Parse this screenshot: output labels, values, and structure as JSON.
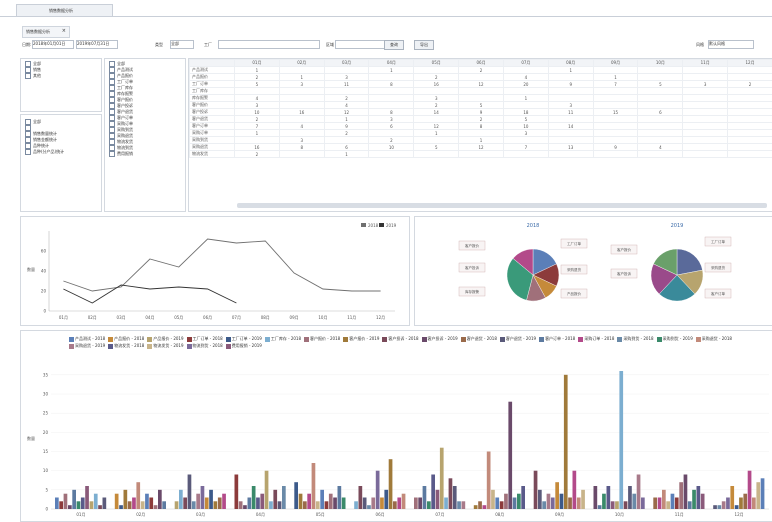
{
  "window": {
    "tab_label": "销售数据分析"
  },
  "document": {
    "tab_label": "销售数据分析"
  },
  "toolbar": {
    "date_label": "日期:",
    "date_from": "2018年01月01日",
    "date_to": "2019年07月31日",
    "type_label": "类型",
    "type_value": "全部",
    "factory_label": "工厂",
    "factory_value": "",
    "dept_label": "区域",
    "dept_value": "",
    "query_button": "查询",
    "export_button": "导出",
    "style_label": "风格",
    "style_value": "默认风格"
  },
  "left_tree_top": {
    "items": [
      "全部",
      "销售",
      "其他"
    ]
  },
  "left_tree_bottom": {
    "items": [
      "全部",
      "",
      "销售数量统计",
      "销售金额统计",
      "品种统计",
      "品种(分产品)统计"
    ]
  },
  "middle_list": {
    "items": [
      "全部",
      "产品测试",
      "产品报价",
      "工厂订单",
      "工厂库存",
      "库存报警",
      "客户报价",
      "客户投诉",
      "客户退货",
      "客户订单",
      "采购订单",
      "采购到货",
      "采购退货",
      "物流发货",
      "物流到货",
      "费用报销"
    ]
  },
  "grid": {
    "header": [
      "",
      "01月",
      "02月",
      "03月",
      "04月",
      "05月",
      "06月",
      "07月",
      "08月",
      "09月",
      "10月",
      "11月",
      "12月"
    ],
    "rows": [
      {
        "label": "产品测试",
        "values": [
          "1",
          "",
          "",
          "1",
          "",
          "2",
          "",
          "1",
          "",
          "",
          "",
          ""
        ]
      },
      {
        "label": "产品报价",
        "values": [
          "2",
          "1",
          "3",
          "",
          "2",
          "",
          "4",
          "",
          "1",
          "",
          "",
          ""
        ]
      },
      {
        "label": "工厂订单",
        "values": [
          "5",
          "3",
          "11",
          "8",
          "16",
          "12",
          "20",
          "9",
          "7",
          "5",
          "3",
          "2"
        ]
      },
      {
        "label": "工厂库存",
        "values": [
          "",
          "",
          "",
          "",
          "",
          "",
          "",
          "",
          "",
          "",
          "",
          ""
        ]
      },
      {
        "label": "库存报警",
        "values": [
          "4",
          "",
          "2",
          "",
          "3",
          "",
          "1",
          "",
          "",
          "",
          "",
          ""
        ]
      },
      {
        "label": "客户报价",
        "values": [
          "3",
          "",
          "4",
          "",
          "2",
          "5",
          "",
          "3",
          "",
          "",
          "",
          ""
        ]
      },
      {
        "label": "客户投诉",
        "values": [
          "10",
          "16",
          "12",
          "8",
          "14",
          "9",
          "18",
          "11",
          "15",
          "6",
          "",
          ""
        ]
      },
      {
        "label": "客户退货",
        "values": [
          "2",
          "",
          "1",
          "3",
          "",
          "2",
          "5",
          "",
          "",
          "",
          "",
          ""
        ]
      },
      {
        "label": "客户订单",
        "values": [
          "7",
          "4",
          "9",
          "6",
          "12",
          "8",
          "10",
          "14",
          "",
          "",
          "",
          ""
        ]
      },
      {
        "label": "采购订单",
        "values": [
          "1",
          "",
          "2",
          "",
          "1",
          "",
          "3",
          "",
          "",
          "",
          "",
          ""
        ]
      },
      {
        "label": "采购到货",
        "values": [
          "",
          "3",
          "",
          "2",
          "",
          "1",
          "",
          "",
          "",
          "",
          "",
          ""
        ]
      },
      {
        "label": "采购退货",
        "values": [
          "16",
          "8",
          "6",
          "10",
          "5",
          "12",
          "7",
          "13",
          "9",
          "4",
          "",
          ""
        ]
      },
      {
        "label": "物流发货",
        "values": [
          "2",
          "",
          "1",
          "",
          "",
          "",
          "",
          "",
          "",
          "",
          "",
          ""
        ]
      }
    ]
  },
  "line_chart_meta": {
    "legend_2018": "2018",
    "legend_2019": "2019"
  },
  "pies": {
    "left_title": "2018",
    "right_title": "2019",
    "left_labels": [
      "客户报价",
      "客户投诉",
      "库存报警",
      "工厂订单",
      "采购退货",
      "产品报价"
    ],
    "right_labels": [
      "客户报价",
      "客户投诉",
      "工厂订单",
      "采购退货",
      "客户订单"
    ]
  },
  "bar_legend": {
    "items": [
      {
        "label": "产品测试 - 2018",
        "color": "#5b7fb8"
      },
      {
        "label": "产品报价 - 2018",
        "color": "#c58a3a"
      },
      {
        "label": "产品报价 - 2019",
        "color": "#b7a46e"
      },
      {
        "label": "工厂订单 - 2018",
        "color": "#8c3b3b"
      },
      {
        "label": "工厂订单 - 2019",
        "color": "#3c5a8a"
      },
      {
        "label": "工厂库存 - 2018",
        "color": "#7caed0"
      },
      {
        "label": "客户报价 - 2018",
        "color": "#a0707a"
      },
      {
        "label": "客户报价 - 2019",
        "color": "#a07a3a"
      },
      {
        "label": "客户投诉 - 2018",
        "color": "#7a4a5a"
      },
      {
        "label": "客户投诉 - 2019",
        "color": "#6a4a6a"
      },
      {
        "label": "客户退货 - 2018",
        "color": "#9a6a4a"
      },
      {
        "label": "客户退货 - 2019",
        "color": "#5a5a7a"
      },
      {
        "label": "客户订单 - 2018",
        "color": "#5c7aa0"
      },
      {
        "label": "采购订单 - 2018",
        "color": "#b34a8a"
      },
      {
        "label": "采购到货 - 2018",
        "color": "#6a8aa8"
      },
      {
        "label": "采购到货 - 2019",
        "color": "#3a8a6a"
      },
      {
        "label": "采购退货 - 2018",
        "color": "#c28a7a"
      },
      {
        "label": "采购退货 - 2019",
        "color": "#a87a8a"
      },
      {
        "label": "物流发货 - 2018",
        "color": "#5a5a8a"
      },
      {
        "label": "物流发货 - 2019",
        "color": "#c8b48a"
      },
      {
        "label": "物流到货 - 2018",
        "color": "#7a6a9a"
      },
      {
        "label": "费用报销 - 2019",
        "color": "#8a5a7a"
      }
    ]
  },
  "chart_data": [
    {
      "type": "line",
      "title": "",
      "xlabel": "",
      "ylabel": "数量",
      "categories": [
        "01月",
        "02月",
        "03月",
        "04月",
        "05月",
        "06月",
        "07月",
        "08月",
        "09月",
        "10月",
        "11月",
        "12月"
      ],
      "ylim": [
        0,
        80
      ],
      "yticks": [
        0,
        20,
        40,
        60
      ],
      "series": [
        {
          "name": "2018",
          "color": "#707070",
          "values": [
            30,
            20,
            24,
            52,
            44,
            72,
            68,
            70,
            38,
            22,
            20,
            20
          ]
        },
        {
          "name": "2019",
          "color": "#333333",
          "values": [
            22,
            8,
            26,
            22,
            24,
            22,
            8,
            null,
            null,
            null,
            null,
            null
          ]
        }
      ],
      "legend": "top-right"
    },
    {
      "type": "pie",
      "title": "2018",
      "values": [
        18,
        14,
        10,
        12,
        32,
        14
      ],
      "colors": [
        "#5b7fb8",
        "#8c3b3b",
        "#c58a3a",
        "#a0707a",
        "#3a9a7a",
        "#b34a8a"
      ]
    },
    {
      "type": "pie",
      "title": "2019",
      "values": [
        22,
        16,
        24,
        20,
        18
      ],
      "colors": [
        "#5a6a9a",
        "#b7a46e",
        "#3a8a9a",
        "#9a4a8a",
        "#6aa06a"
      ]
    },
    {
      "type": "bar",
      "title": "",
      "xlabel": "",
      "ylabel": "数量",
      "categories": [
        "01月",
        "02月",
        "03月",
        "04月",
        "05月",
        "06月",
        "07月",
        "08月",
        "09月",
        "10月",
        "11月",
        "12月"
      ],
      "ylim": [
        0,
        36
      ],
      "yticks": [
        0,
        5,
        10,
        15,
        20,
        25,
        30,
        35
      ],
      "series_values": [
        [
          3,
          4,
          2,
          9,
          7,
          2,
          3,
          1,
          10,
          6,
          3,
          1
        ],
        [
          2,
          1,
          5,
          2,
          4,
          6,
          3,
          2,
          5,
          1,
          3,
          1
        ],
        [
          4,
          5,
          3,
          1,
          2,
          3,
          6,
          1,
          2,
          4,
          5,
          2
        ],
        [
          1,
          2,
          9,
          3,
          4,
          1,
          2,
          15,
          4,
          6,
          2,
          3
        ],
        [
          5,
          3,
          2,
          6,
          12,
          3,
          9,
          5,
          3,
          2,
          4,
          6
        ],
        [
          2,
          7,
          4,
          3,
          2,
          10,
          5,
          3,
          7,
          2,
          3,
          1
        ],
        [
          3,
          2,
          6,
          4,
          5,
          3,
          16,
          2,
          4,
          36,
          7,
          3
        ],
        [
          6,
          4,
          3,
          10,
          2,
          5,
          3,
          4,
          35,
          2,
          9,
          4
        ],
        [
          2,
          3,
          5,
          2,
          4,
          13,
          8,
          28,
          3,
          6,
          2,
          10
        ],
        [
          4,
          1,
          2,
          5,
          3,
          2,
          6,
          3,
          10,
          4,
          5,
          3
        ],
        [
          1,
          5,
          3,
          2,
          6,
          3,
          2,
          4,
          3,
          9,
          6,
          7
        ],
        [
          3,
          2,
          4,
          6,
          3,
          4,
          2,
          6,
          5,
          3,
          4,
          8
        ]
      ]
    }
  ]
}
